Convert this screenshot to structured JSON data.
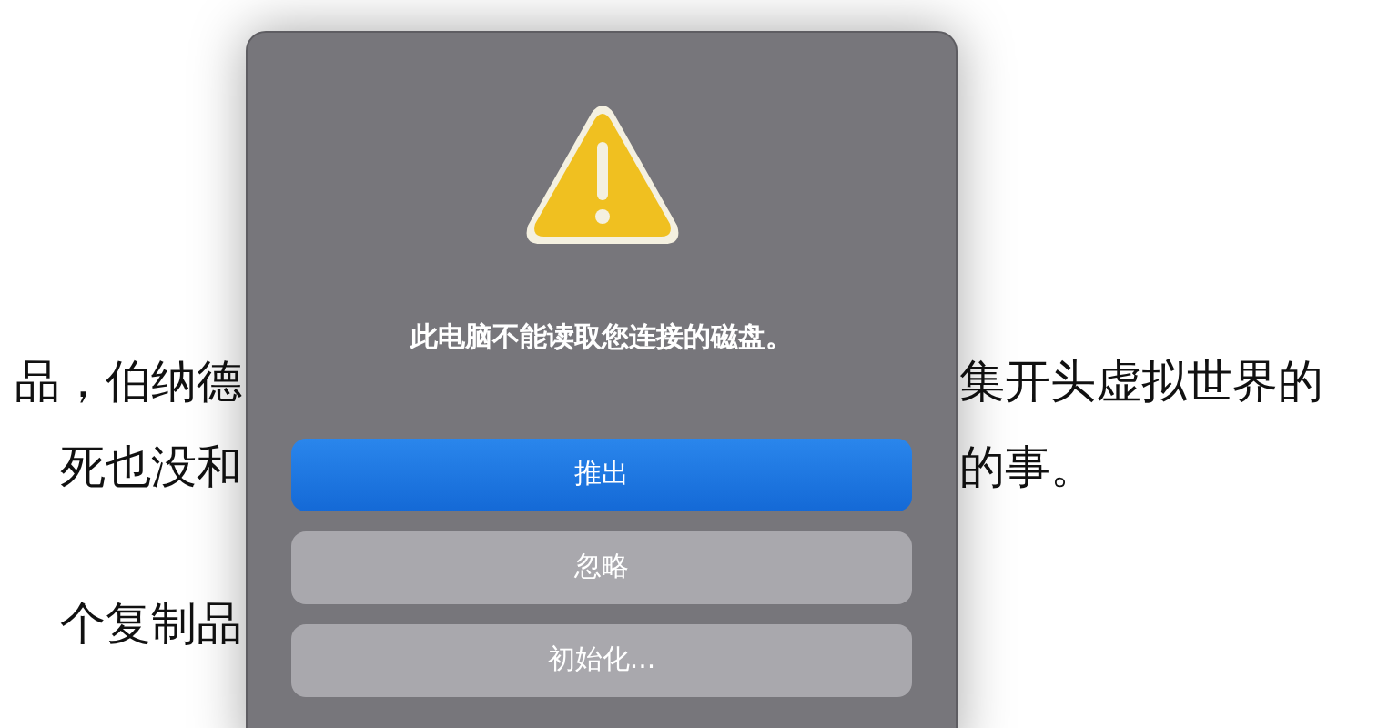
{
  "background_text": [
    {
      "left": "品，伯纳德",
      "right": "集开头虚拟世界的"
    },
    {
      "left": "死也没和",
      "right": "的事。"
    },
    {
      "left": "个复制品"
    }
  ],
  "dialog": {
    "message": "此电脑不能读取您连接的磁盘。",
    "buttons": [
      {
        "label": "推出",
        "default": true
      },
      {
        "label": "忽略",
        "default": false
      },
      {
        "label": "初始化...",
        "default": false
      }
    ]
  }
}
